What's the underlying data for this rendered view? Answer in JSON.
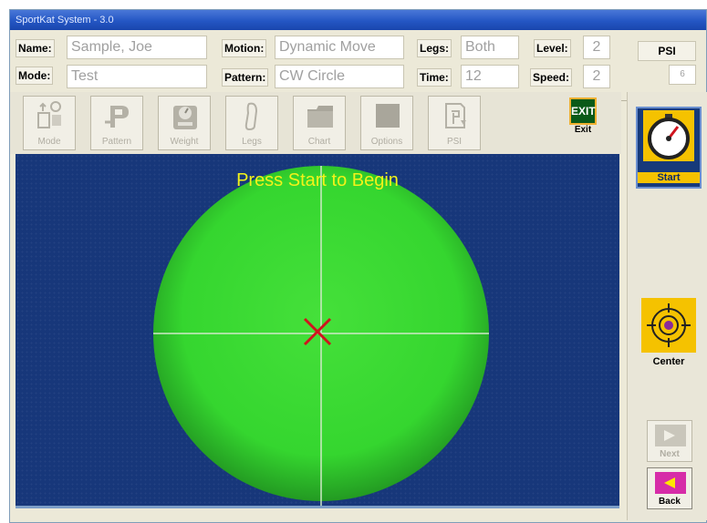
{
  "window": {
    "title": "SportKat System - 3.0"
  },
  "info": {
    "name_label": "Name:",
    "name_value": "Sample, Joe",
    "mode_label": "Mode:",
    "mode_value": "Test",
    "motion_label": "Motion:",
    "motion_value": "Dynamic Move",
    "pattern_label": "Pattern:",
    "pattern_value": "CW Circle",
    "legs_label": "Legs:",
    "legs_value": "Both",
    "time_label": "Time:",
    "time_value": "12",
    "level_label": "Level:",
    "level_value": "2",
    "speed_label": "Speed:",
    "speed_value": "2",
    "psi_label": "PSI",
    "psi_value": "6"
  },
  "toolbar": {
    "items": [
      {
        "label": "Mode",
        "icon": "mode-icon"
      },
      {
        "label": "Pattern",
        "icon": "pattern-icon"
      },
      {
        "label": "Weight",
        "icon": "weight-icon"
      },
      {
        "label": "Legs",
        "icon": "legs-icon"
      },
      {
        "label": "Chart",
        "icon": "chart-icon"
      },
      {
        "label": "Options",
        "icon": "options-icon"
      },
      {
        "label": "PSI",
        "icon": "psi-icon"
      }
    ],
    "exit_sign": "EXIT",
    "exit_label": "Exit"
  },
  "canvas": {
    "prompt": "Press Start to Begin",
    "background_color": "#17377a",
    "target_color": "#35d62f",
    "prompt_color": "#f2f21a",
    "marker_color": "#d0141e"
  },
  "side": {
    "start_label": "Start",
    "center_label": "Center",
    "next_label": "Next",
    "back_label": "Back"
  }
}
